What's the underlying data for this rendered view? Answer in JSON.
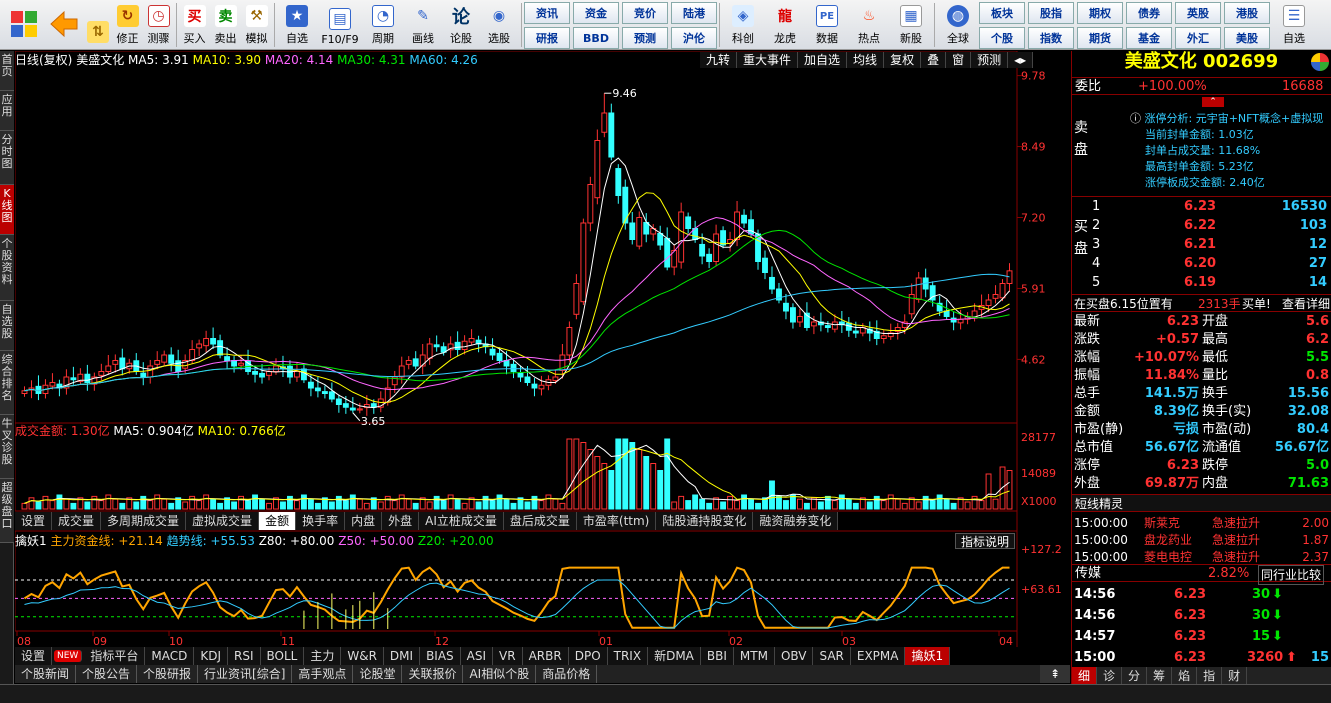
{
  "toolbar": {
    "buttons": [
      "修正",
      "测骤",
      "买入",
      "卖出",
      "模拟",
      "自选",
      "F10/F9",
      "周期",
      "画线",
      "论股",
      "选股"
    ],
    "grid1": [
      "资讯",
      "资金",
      "竞价",
      "陆港",
      "研报",
      "BBD",
      "预测",
      "沪伦"
    ],
    "icon_btns": [
      "科创",
      "龙虎",
      "数据",
      "热点",
      "新股"
    ],
    "global": "全球",
    "grid2": [
      "板块",
      "股指",
      "期权",
      "债券",
      "英股",
      "港股",
      "个股",
      "指数",
      "期货",
      "基金",
      "外汇",
      "美股"
    ],
    "last": "自选"
  },
  "sidebar": [
    "首页",
    "应用",
    "分时图",
    "K线图",
    "个股资料",
    "自选股",
    "综合排名",
    "牛叉诊股",
    "超级盘口"
  ],
  "chart": {
    "header": {
      "period": "日线(复权)",
      "name": "美盛文化",
      "ma5": "MA5: 3.91",
      "ma10": "MA10: 3.90",
      "ma20": "MA20: 4.14",
      "ma30": "MA30: 4.31",
      "ma60": "MA60: 4.26"
    },
    "top_buttons": [
      "九转",
      "重大事件",
      "加自选",
      "均线",
      "复权",
      "叠",
      "窗",
      "预测"
    ],
    "price_axis": [
      "9.78",
      "8.49",
      "7.20",
      "5.91",
      "4.62"
    ],
    "high_label": "9.46",
    "low_label": "3.65",
    "vol_header": {
      "amount": "成交金额: 1.30亿",
      "ma5": "MA5: 0.904亿",
      "ma10": "MA10: 0.766亿"
    },
    "vol_axis": [
      "28177",
      "14089",
      "X1000"
    ],
    "vol_tabs": [
      "设置",
      "成交量",
      "多周期成交量",
      "虚拟成交量",
      "金额",
      "换手率",
      "内盘",
      "外盘",
      "AI立桩成交量",
      "盘后成交量",
      "市盈率(ttm)",
      "陆股通持股变化",
      "融资融券变化"
    ],
    "ind_header": {
      "name": "擒妖1",
      "main": "主力资金线: +21.14",
      "trend": "趋势线: +55.53",
      "z80": "Z80: +80.00",
      "z50": "Z50: +50.00",
      "z20": "Z20: +20.00"
    },
    "ind_button": "指标说明",
    "ind_axis": [
      "+127.2",
      "+63.61"
    ],
    "months": [
      "08",
      "09",
      "10",
      "11",
      "12",
      "01",
      "02",
      "03",
      "04"
    ],
    "ind_tabs": [
      "设置",
      "NEW",
      "指标平台",
      "MACD",
      "KDJ",
      "RSI",
      "BOLL",
      "主力",
      "W&R",
      "DMI",
      "BIAS",
      "ASI",
      "VR",
      "ARBR",
      "DPO",
      "TRIX",
      "新DMA",
      "BBI",
      "MTM",
      "OBV",
      "SAR",
      "EXPMA",
      "擒妖1"
    ],
    "bottom_tabs": [
      "个股新闻",
      "个股公告",
      "个股研报",
      "行业资讯[综合]",
      "高手观点",
      "论股堂",
      "关联报价",
      "AI相似个股",
      "商品价格"
    ]
  },
  "chart_data": {
    "type": "candlestick",
    "y_price_range": [
      3.5,
      9.9
    ],
    "closes": [
      4.05,
      4.1,
      4.0,
      4.15,
      4.2,
      4.1,
      4.3,
      4.25,
      4.35,
      4.2,
      4.3,
      4.4,
      4.5,
      4.6,
      4.45,
      4.55,
      4.4,
      4.3,
      4.5,
      4.6,
      4.7,
      4.55,
      4.4,
      4.6,
      4.8,
      4.9,
      5.0,
      4.9,
      4.7,
      4.6,
      4.5,
      4.55,
      4.4,
      4.35,
      4.3,
      4.4,
      4.5,
      4.45,
      4.3,
      4.4,
      4.25,
      4.1,
      4.05,
      4.0,
      3.9,
      3.8,
      3.75,
      3.7,
      3.72,
      3.8,
      3.75,
      3.9,
      4.1,
      4.3,
      4.5,
      4.6,
      4.5,
      4.7,
      4.9,
      4.85,
      4.75,
      4.9,
      4.8,
      4.95,
      5.0,
      4.9,
      4.85,
      4.7,
      4.6,
      4.5,
      4.4,
      4.3,
      4.2,
      4.1,
      4.15,
      4.25,
      4.3,
      4.7,
      5.2,
      6.0,
      7.1,
      7.8,
      8.6,
      9.1,
      8.3,
      7.6,
      7.1,
      6.8,
      7.2,
      6.9,
      7.0,
      6.7,
      6.3,
      6.6,
      7.3,
      7.0,
      6.8,
      6.5,
      6.4,
      6.9,
      6.7,
      6.8,
      7.3,
      7.1,
      6.9,
      6.4,
      6.2,
      5.9,
      5.7,
      5.5,
      5.3,
      5.4,
      5.2,
      5.3,
      5.25,
      5.2,
      5.3,
      5.25,
      5.15,
      5.1,
      5.2,
      5.1,
      5.0,
      5.05,
      5.1,
      5.2,
      5.3,
      5.8,
      6.1,
      5.9,
      5.7,
      5.5,
      5.4,
      5.3,
      5.35,
      5.4,
      5.5,
      5.6,
      5.7,
      5.8,
      6.0,
      6.23
    ],
    "low_label": 3.65,
    "high_label": 9.46,
    "volume_max": 28177
  },
  "rightpanel": {
    "title": "美盛文化 002699",
    "weibi_label": "委比",
    "weibi": "+100.00%",
    "weicha": "16688",
    "limit_info": [
      "涨停分析: 元宇宙+NFT概念+虚拟现",
      "当前封单金额: 1.03亿",
      "封单占成交量: 11.68%",
      "最高封单金额: 5.23亿",
      "涨停板成交金额: 2.40亿"
    ],
    "sell_label": "卖盘",
    "buy_label": "买盘",
    "buys": [
      {
        "n": "1",
        "p": "6.23",
        "v": "16530"
      },
      {
        "n": "2",
        "p": "6.22",
        "v": "103"
      },
      {
        "n": "3",
        "p": "6.21",
        "v": "12"
      },
      {
        "n": "4",
        "p": "6.20",
        "v": "27"
      },
      {
        "n": "5",
        "p": "6.19",
        "v": "14"
      }
    ],
    "notice": {
      "text": "在买盘6.15位置有",
      "vol": "2313手",
      "act": "买单!",
      "more": "查看详细"
    },
    "quote": [
      {
        "l": "最新",
        "v": "6.23",
        "l2": "开盘",
        "v2": "5.6"
      },
      {
        "l": "涨跌",
        "v": "+0.57",
        "l2": "最高",
        "v2": "6.2"
      },
      {
        "l": "涨幅",
        "v": "+10.07%",
        "l2": "最低",
        "v2": "5.5"
      },
      {
        "l": "振幅",
        "v": "11.84%",
        "l2": "量比",
        "v2": "0.8"
      },
      {
        "l": "总手",
        "v": "141.5万",
        "l2": "换手",
        "v2": "15.56"
      },
      {
        "l": "金额",
        "v": "8.39亿",
        "l2": "换手(实)",
        "v2": "32.08"
      },
      {
        "l": "市盈(静)",
        "v": "亏损",
        "l2": "市盈(动)",
        "v2": "80.4"
      },
      {
        "l": "总市值",
        "v": "56.67亿",
        "l2": "流通值",
        "v2": "56.67亿"
      },
      {
        "l": "涨停",
        "v": "6.23",
        "l2": "跌停",
        "v2": "5.0"
      },
      {
        "l": "外盘",
        "v": "69.87万",
        "l2": "内盘",
        "v2": "71.63"
      }
    ],
    "short_title": "短线精灵",
    "short": [
      {
        "t": "15:00:00",
        "n": "斯莱克",
        "a": "急速拉升",
        "v": "2.00"
      },
      {
        "t": "15:00:00",
        "n": "盘龙药业",
        "a": "急速拉升",
        "v": "1.87"
      },
      {
        "t": "15:00:00",
        "n": "菱电电控",
        "a": "急速拉升",
        "v": "2.37"
      }
    ],
    "sector": {
      "name": "传媒",
      "pct": "2.82%",
      "btn": "同行业比较"
    },
    "ticks": [
      {
        "t": "14:56",
        "p": "6.23",
        "v": "30"
      },
      {
        "t": "14:56",
        "p": "6.23",
        "v": "30"
      },
      {
        "t": "14:57",
        "p": "6.23",
        "v": "15"
      },
      {
        "t": "15:00",
        "p": "6.23",
        "v": "3260",
        "v2": "15"
      }
    ],
    "bottom_tabs": [
      "细",
      "诊",
      "分",
      "筹",
      "焰",
      "指",
      "财"
    ]
  }
}
